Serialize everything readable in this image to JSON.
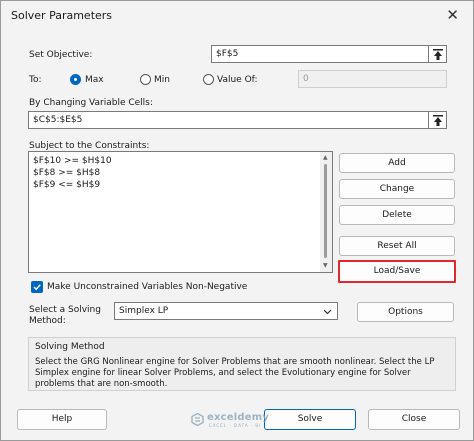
{
  "window": {
    "title": "Solver Parameters",
    "close_glyph": "✕"
  },
  "objective": {
    "label": "Set Objective:",
    "value": "$F$5"
  },
  "to": {
    "label": "To:",
    "options": [
      {
        "label": "Max",
        "selected": true
      },
      {
        "label": "Min",
        "selected": false
      },
      {
        "label": "Value Of:",
        "selected": false
      }
    ],
    "value_of": "0"
  },
  "changing_cells": {
    "label": "By Changing Variable Cells:",
    "value": "$C$5:$E$5"
  },
  "constraints": {
    "label": "Subject to the Constraints:",
    "items": [
      "$F$10 >= $H$10",
      "$F$8 >= $H$8",
      "$F$9 <= $H$9"
    ]
  },
  "side_buttons": {
    "add": "Add",
    "change": "Change",
    "delete": "Delete",
    "reset_all": "Reset All",
    "load_save": "Load/Save"
  },
  "nonnegative": {
    "label": "Make Unconstrained Variables Non-Negative",
    "checked": true
  },
  "solving_method": {
    "label_line1": "Select a Solving",
    "label_line2": "Method:",
    "selected": "Simplex LP",
    "options_button": "Options"
  },
  "method_group": {
    "title": "Solving Method",
    "text": "Select the GRG Nonlinear engine for Solver Problems that are smooth nonlinear. Select the LP Simplex engine for linear Solver Problems, and select the Evolutionary engine for Solver problems that are non-smooth."
  },
  "footer": {
    "help": "Help",
    "solve": "Solve",
    "close": "Close"
  },
  "watermark": {
    "name": "exceldemy",
    "tagline": "EXCEL · DATA · BI"
  },
  "colors": {
    "accent": "#0067c0",
    "highlight": "#e0292e"
  }
}
